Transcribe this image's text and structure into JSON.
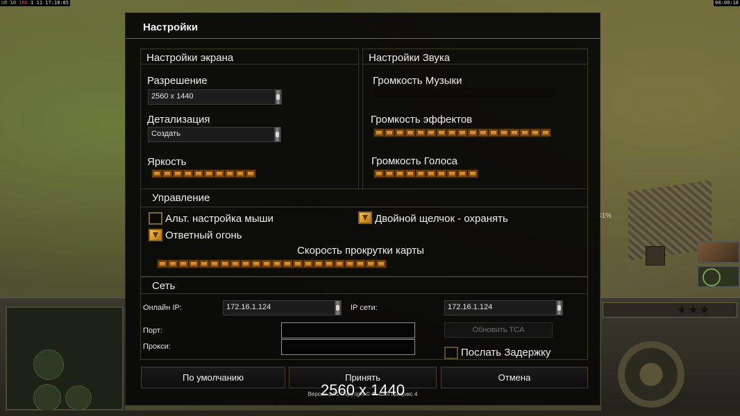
{
  "hud": {
    "top_left": {
      "seg1": "UR",
      "seg2": "10",
      "seg3": "166",
      "seg4": "1 11",
      "seg5": "17:18:05"
    },
    "top_right": "00:00:18",
    "peek_text": "ка 31%"
  },
  "dialog": {
    "title": "Настройки",
    "screen": {
      "header": "Настройки экрана",
      "resolution_label": "Разрешение",
      "resolution_value": "2560 x 1440",
      "detail_label": "Детализация",
      "detail_value": "Создать",
      "brightness_label": "Яркость",
      "brightness_level": 10,
      "brightness_max": 10
    },
    "sound": {
      "header": "Настройки Звука",
      "music_label": "Громкость Музыки",
      "music_level": 0,
      "effects_label": "Громкость эффектов",
      "effects_level": 17,
      "effects_max": 17,
      "voice_label": "Громкость Голоса",
      "voice_level": 10,
      "voice_max": 10
    },
    "control": {
      "header": "Управление",
      "alt_mouse_label": "Альт. настройка мыши",
      "alt_mouse_checked": false,
      "double_click_label": "Двойной щелчок - охранять",
      "double_click_checked": true,
      "return_fire_label": "Ответный огонь",
      "return_fire_checked": true,
      "scroll_label": "Скорость прокрутки карты",
      "scroll_level": 22,
      "scroll_max": 22
    },
    "network": {
      "header": "Сеть",
      "online_ip_label": "Онлайн IP:",
      "online_ip_value": "172.16.1.124",
      "lan_ip_label": "IP сети:",
      "lan_ip_value": "172.16.1.124",
      "port_label": "Порт:",
      "proxy_label": "Прокси:",
      "update_tca_label": "Обновить TCA",
      "send_delay_label": "Послать Задержку",
      "send_delay_checked": false
    },
    "buttons": {
      "defaults": "По умолчанию",
      "accept": "Принять",
      "cancel": "Отмена"
    },
    "version_text": "Версия 1.01  Copyright © Фьюжн Графикс 4"
  },
  "overlay_resolution": "2560 x 1440",
  "colors": {
    "accent_orange": "#f4b048",
    "border_gold": "#806a34"
  }
}
